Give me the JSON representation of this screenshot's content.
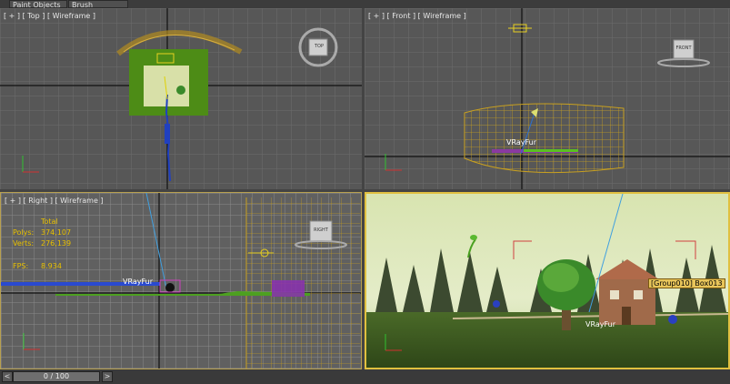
{
  "menu": {
    "tabs": [
      "Paint Objects",
      "Brush Settings"
    ]
  },
  "viewports": {
    "top": {
      "label": "[ + ] [ Top ] [ Wireframe ]",
      "cube_label": "TOP"
    },
    "front": {
      "label": "[ + ] [ Front ] [ Wireframe ]",
      "cube_label": "FRONT",
      "object_label": "VRayFur"
    },
    "right": {
      "label": "[ + ] [ Right ] [ Wireframe ]",
      "cube_label": "RIGHT",
      "object_label": "VRayFur",
      "stats": {
        "total_label": "Total",
        "polys_label": "Polys:",
        "polys_value": "374,107",
        "verts_label": "Verts:",
        "verts_value": "276,139",
        "fps_label": "FPS:",
        "fps_value": "8.934"
      }
    },
    "perspective": {
      "object_label": "VRayFur",
      "tooltip": "[Group010] Box013"
    }
  },
  "timeline": {
    "prev": "<",
    "frame_display": "0 / 100",
    "next": ">"
  },
  "colors": {
    "viewport_bg": "#575757",
    "grid": "#7a7a7a",
    "active_border": "#e0c040",
    "wire_yellow": "#c8a020",
    "grass": "#4a8a1a"
  }
}
